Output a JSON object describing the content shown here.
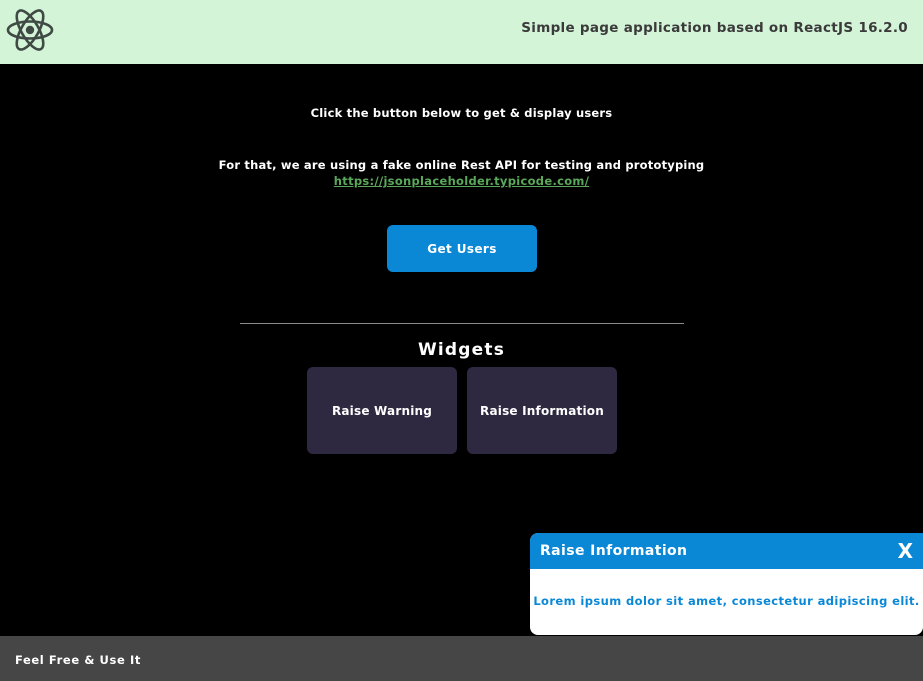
{
  "header": {
    "logo_icon": "react-atom-icon",
    "title": "Simple page application based on ReactJS 16.2.0"
  },
  "main": {
    "intro_line_1": "Click the button below to get & display users",
    "intro_line_2": "For that, we are using a fake online Rest API for testing and prototyping",
    "api_link": "https://jsonplaceholder.typicode.com/",
    "get_users_label": "Get Users",
    "widgets_heading": "Widgets",
    "widgets": [
      {
        "label": "Raise Warning"
      },
      {
        "label": "Raise Information"
      }
    ]
  },
  "notification": {
    "title": "Raise Information",
    "close_label": "X",
    "message": "Lorem ipsum dolor sit amet, consectetur adipiscing elit."
  },
  "footer": {
    "text": "Feel Free & Use It"
  },
  "colors": {
    "header_bg": "#d4f4d8",
    "page_bg": "#000000",
    "accent": "#0a88d6",
    "widget_bg": "#2e2940",
    "footer_bg": "#464646",
    "link": "#5aa85a"
  }
}
